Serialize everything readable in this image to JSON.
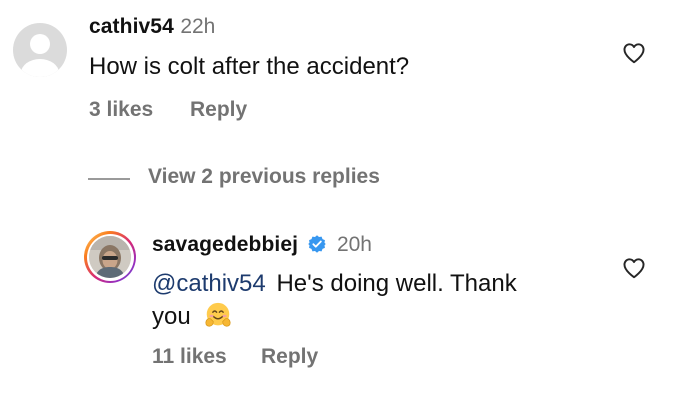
{
  "comment": {
    "username": "cathiv54",
    "timestamp": "22h",
    "text": "How is colt after the accident?",
    "likes": "3 likes",
    "reply_label": "Reply",
    "heart_icon": "heart-outline-icon",
    "avatar_icon": "default-avatar-icon"
  },
  "replies_toggle": {
    "label": "View 2 previous replies"
  },
  "reply": {
    "username": "savagedebbiej",
    "verified_icon": "verified-badge-icon",
    "timestamp": "20h",
    "mention": "@cathiv54",
    "text_line1": "He's doing well. Thank",
    "text_line2": "you",
    "emoji": "hugging-face-emoji",
    "likes": "11 likes",
    "reply_label": "Reply",
    "heart_icon": "heart-outline-icon"
  },
  "colors": {
    "muted": "#737373",
    "mention": "#1d3b6e",
    "verified": "#3797f0",
    "avatar_placeholder": "#dbdbdb"
  }
}
